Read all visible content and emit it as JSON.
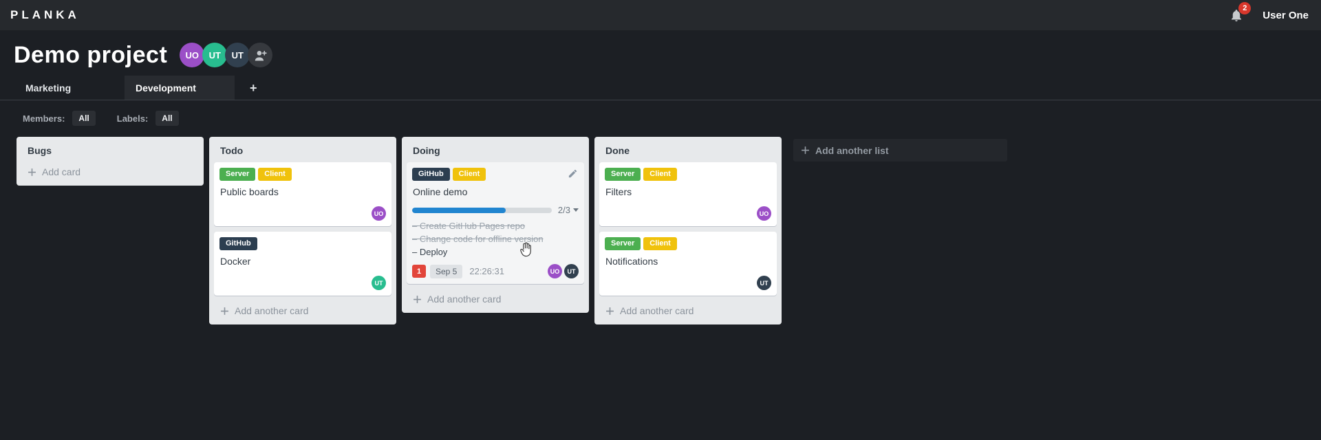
{
  "topbar": {
    "logo": "PLANKA",
    "notifications_count": "2",
    "user_name": "User One"
  },
  "project": {
    "title": "Demo project",
    "members": [
      {
        "initials": "UO",
        "color": "#9b4fc7"
      },
      {
        "initials": "UT",
        "color": "#28bd8f"
      },
      {
        "initials": "UT",
        "color": "#31404f"
      }
    ]
  },
  "tabs": {
    "items": [
      {
        "label": "Marketing"
      },
      {
        "label": "Development"
      }
    ],
    "add_label": "+"
  },
  "filters": {
    "members_label": "Members:",
    "members_value": "All",
    "labels_label": "Labels:",
    "labels_value": "All"
  },
  "board": {
    "add_list_label": "Add another list",
    "lists": [
      {
        "title": "Bugs",
        "add_card_label": "Add card",
        "cards": []
      },
      {
        "title": "Todo",
        "add_card_label": "Add another card",
        "cards": [
          {
            "title": "Public boards",
            "labels": [
              {
                "text": "Server",
                "color": "#4caf50"
              },
              {
                "text": "Client",
                "color": "#f0c20c"
              }
            ],
            "members": [
              {
                "initials": "UO",
                "color": "#9b4fc7"
              }
            ]
          },
          {
            "title": "Docker",
            "labels": [
              {
                "text": "GitHub",
                "color": "#2c3e50"
              }
            ],
            "members": [
              {
                "initials": "UT",
                "color": "#28bd8f"
              }
            ]
          }
        ]
      },
      {
        "title": "Doing",
        "add_card_label": "Add another card",
        "cards": [
          {
            "title": "Online demo",
            "labels": [
              {
                "text": "GitHub",
                "color": "#2c3e50"
              },
              {
                "text": "Client",
                "color": "#f0c20c"
              }
            ],
            "progress": {
              "display": "2/3",
              "done": 2,
              "total": 3,
              "fill": "67%",
              "color": "#2185d0"
            },
            "tasks": [
              {
                "name": "Create GitHub Pages repo",
                "completed": true
              },
              {
                "name": "Change code for offline version",
                "completed": true
              },
              {
                "name": "Deploy",
                "completed": false
              }
            ],
            "notification_count": "1",
            "due_date": "Sep 5",
            "timer": "22:26:31",
            "members": [
              {
                "initials": "UO",
                "color": "#9b4fc7"
              },
              {
                "initials": "UT",
                "color": "#31404f"
              }
            ]
          }
        ]
      },
      {
        "title": "Done",
        "add_card_label": "Add another card",
        "cards": [
          {
            "title": "Filters",
            "labels": [
              {
                "text": "Server",
                "color": "#4caf50"
              },
              {
                "text": "Client",
                "color": "#f0c20c"
              }
            ],
            "members": [
              {
                "initials": "UO",
                "color": "#9b4fc7"
              }
            ]
          },
          {
            "title": "Notifications",
            "labels": [
              {
                "text": "Server",
                "color": "#4caf50"
              },
              {
                "text": "Client",
                "color": "#f0c20c"
              }
            ],
            "members": [
              {
                "initials": "UT",
                "color": "#31404f"
              }
            ]
          }
        ]
      }
    ]
  }
}
